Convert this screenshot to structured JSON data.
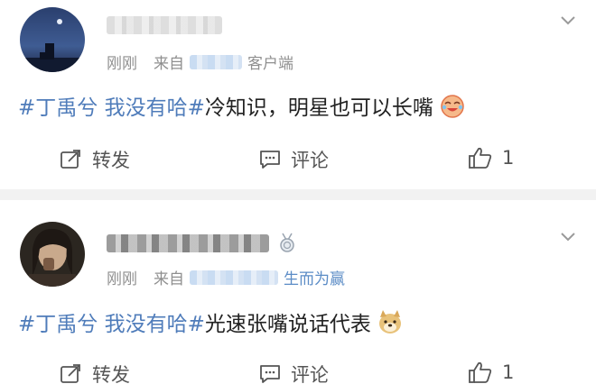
{
  "posts": [
    {
      "time": "刚刚",
      "source_prefix": "来自",
      "source_suffix": "客户端",
      "hashtag": "#丁禹兮 我没有哈#",
      "text": "冷知识，明星也可以长嘴",
      "emoji_icon": "laughing-crying-emoji",
      "repost_label": "转发",
      "comment_label": "评论",
      "like_count": "1"
    },
    {
      "time": "刚刚",
      "source_prefix": "来自",
      "source_suffix": "生而为赢",
      "hashtag": "#丁禹兮 我没有哈#",
      "text": "光速张嘴说话代表",
      "emoji_icon": "doge-emoji",
      "repost_label": "转发",
      "comment_label": "评论",
      "like_count": "1"
    }
  ],
  "colors": {
    "hashtag": "#4f7cba",
    "meta": "#8f8f8f",
    "client_link": "#5b8cc6",
    "separator": "#f2f2f2"
  }
}
